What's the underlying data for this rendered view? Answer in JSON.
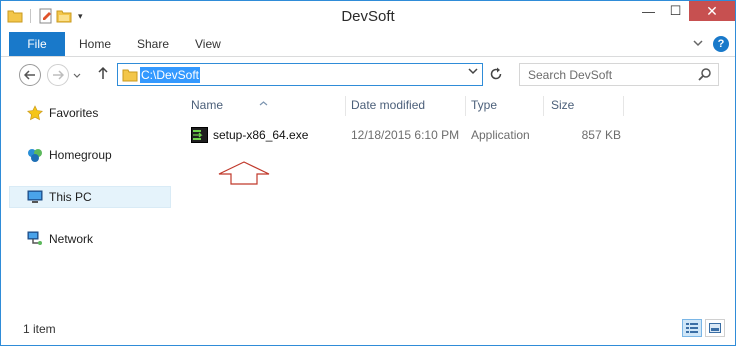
{
  "window": {
    "title": "DevSoft"
  },
  "quick_access": {
    "icons": [
      "properties-icon",
      "new-folder-icon",
      "folder-icon"
    ],
    "dropdown": "▾"
  },
  "window_controls": {
    "minimize": "—",
    "maximize": "☐",
    "close": "✕"
  },
  "ribbon": {
    "tabs": [
      {
        "label": "File"
      },
      {
        "label": "Home"
      },
      {
        "label": "Share"
      },
      {
        "label": "View"
      }
    ],
    "help": "?"
  },
  "address_bar": {
    "path": "C:\\DevSoft",
    "path_selected": true
  },
  "search": {
    "placeholder": "Search DevSoft"
  },
  "nav_pane": {
    "items": [
      {
        "label": "Favorites",
        "icon": "star-icon"
      },
      {
        "label": "Homegroup",
        "icon": "homegroup-icon"
      },
      {
        "label": "This PC",
        "icon": "computer-icon",
        "selected": true
      },
      {
        "label": "Network",
        "icon": "network-icon"
      }
    ]
  },
  "columns": {
    "name": "Name",
    "date": "Date modified",
    "type": "Type",
    "size": "Size"
  },
  "files": [
    {
      "name": "setup-x86_64.exe",
      "date": "12/18/2015 6:10 PM",
      "type": "Application",
      "size": "857 KB",
      "icon": "executable-icon"
    }
  ],
  "status": {
    "text": "1 item"
  },
  "colors": {
    "accent": "#1979ca",
    "selection": "#3399ff",
    "close_button": "#c75050",
    "pointer_arrow": "#c0392b"
  }
}
